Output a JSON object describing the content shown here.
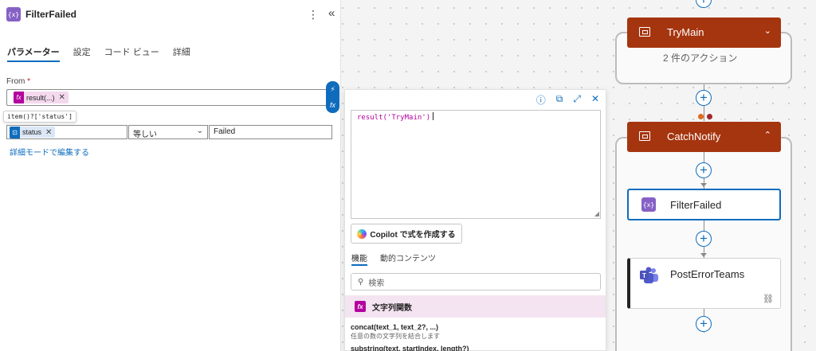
{
  "panel": {
    "title": "FilterFailed",
    "action_icon": "{x}",
    "kebab_icon": "⋮",
    "collapse_icon": "«",
    "tabs": [
      {
        "label": "パラメーター",
        "active": true
      },
      {
        "label": "設定",
        "active": false
      },
      {
        "label": "コード ビュー",
        "active": false
      },
      {
        "label": "詳細",
        "active": false
      }
    ],
    "from_label": "From",
    "required_mark": "*",
    "from_token": {
      "icon": "fx",
      "label": "result(...)"
    },
    "tooltip": "item()?['status']",
    "condition": {
      "left_token": {
        "icon": "⊡",
        "label": "status"
      },
      "operator": "等しい",
      "value": "Failed"
    },
    "advanced_link": "詳細モードで編集する",
    "side_pill": [
      "⚡",
      "fx"
    ]
  },
  "editor": {
    "tools": [
      "ⓘ",
      "⧉",
      "⤢",
      "✕"
    ],
    "expression": "result('TryMain')",
    "copilot_label": "Copilot で式を作成する",
    "tabs": [
      {
        "label": "機能",
        "active": true
      },
      {
        "label": "動的コンテンツ",
        "active": false
      }
    ],
    "search_placeholder": "検索",
    "category": {
      "icon": "fx",
      "label": "文字列関数"
    },
    "functions": [
      {
        "signature": "concat(text_1, text_2?, ...)",
        "description": "任意の数の文字列を結合します"
      },
      {
        "signature": "substring(text, startIndex, length?)",
        "description": ""
      }
    ]
  },
  "flow": {
    "scopes": [
      {
        "title": "TryMain",
        "subtitle": "2 件のアクション",
        "chevron": "⌄",
        "color": "#a5350f"
      },
      {
        "title": "CatchNotify",
        "subtitle": "",
        "chevron": "⌃",
        "color": "#a5350f"
      }
    ],
    "cards": [
      {
        "title": "FilterFailed",
        "icon": "{x}",
        "selected": true
      },
      {
        "title": "PostErrorTeams",
        "icon": "teams",
        "selected": false,
        "link_icon": "⛓"
      }
    ],
    "run_after_colors": [
      "#e06b1f",
      "#a4262c"
    ]
  },
  "colors": {
    "accent": "#0f6cbd",
    "scope": "#a5350f",
    "expression": "#b4009e",
    "data_op": "#8661c5"
  }
}
